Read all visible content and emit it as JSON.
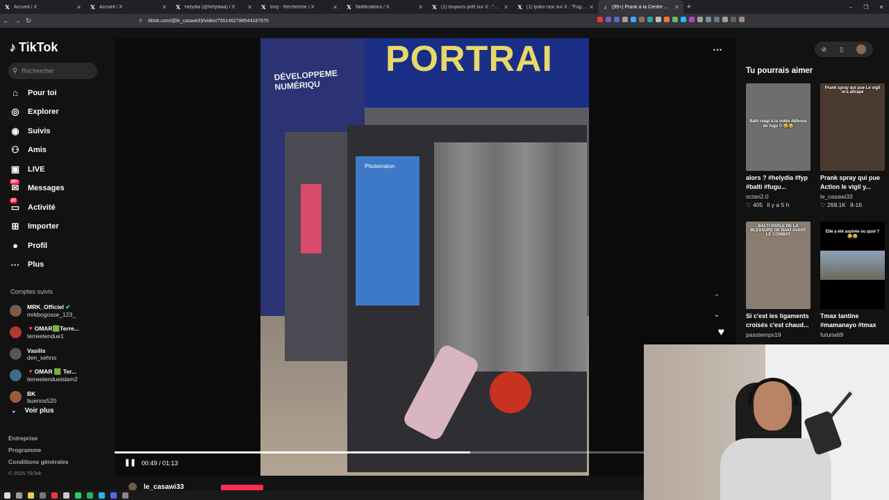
{
  "browser": {
    "tabs": [
      {
        "icon": "x-logo",
        "title": "Accueil / X"
      },
      {
        "icon": "x-logo",
        "title": "Accueil / X"
      },
      {
        "icon": "x-logo",
        "title": "helydia (@helydiaa) / X"
      },
      {
        "icon": "x-logo",
        "title": "trixy - Recherche / X"
      },
      {
        "icon": "x-logo",
        "title": "Notifications / X"
      },
      {
        "icon": "x-logo",
        "title": "(1) toujours prêt sur X : \"AHAHAHA"
      },
      {
        "icon": "x-logo",
        "title": "(1) lysko rsor sur X : \"Fugu quand il"
      },
      {
        "icon": "tiktok-logo",
        "title": "(99+) Prank à la Centre Comm",
        "active": true
      }
    ],
    "url": "tiktok.com/@le_casawi33/video/7551462788544187670",
    "new_tab": "+",
    "window_controls": [
      "–",
      "❐",
      "✕"
    ]
  },
  "sidebar": {
    "logo_text": "TikTok",
    "search_placeholder": "Rechercher",
    "nav": [
      {
        "icon": "home-icon",
        "glyph": "⌂",
        "label": "Pour toi"
      },
      {
        "icon": "compass-icon",
        "glyph": "◎",
        "label": "Explorer"
      },
      {
        "icon": "following-icon",
        "glyph": "◉",
        "label": "Suivis"
      },
      {
        "icon": "friends-icon",
        "glyph": "⚇",
        "label": "Amis"
      },
      {
        "icon": "live-icon",
        "glyph": "▣",
        "label": "LIVE"
      },
      {
        "icon": "messages-icon",
        "glyph": "✉",
        "label": "Messages",
        "badge": "99+"
      },
      {
        "icon": "activity-icon",
        "glyph": "▭",
        "label": "Activité",
        "badge": "22"
      },
      {
        "icon": "upload-icon",
        "glyph": "⊞",
        "label": "Importer"
      },
      {
        "icon": "profile-icon",
        "glyph": "●",
        "label": "Profil"
      },
      {
        "icon": "more-icon",
        "glyph": "···",
        "label": "Plus"
      }
    ],
    "followed_title": "Comptes suivis",
    "followed": [
      {
        "name": "MRK_Officiel",
        "handle": "mrkbogosse_123_",
        "verified": true,
        "color": "#7a5c48"
      },
      {
        "name": "🔻OMAR🟩Terre...",
        "handle": "terreetendue1",
        "color": "#b03a2e"
      },
      {
        "name": "Vasilis",
        "handle": "den_xehno",
        "color": "#555555"
      },
      {
        "name": "🔻OMAR 🟩 Ter...",
        "handle": "terreetendueislam2",
        "color": "#3a6e8c"
      },
      {
        "name": "BK",
        "handle": "buenos520",
        "color": "#9a5b3d"
      }
    ],
    "see_more": "Voir plus",
    "footer": [
      "Entreprise",
      "Programme",
      "Conditions générales"
    ],
    "copyright": "© 2025 TikTok"
  },
  "video": {
    "sign_text": "PORTRAI",
    "left_sign_text": "DÉVELOPPEME NUMÉRIQU",
    "booth_label": "Photomaton",
    "current_time": "00:49",
    "duration": "01:13",
    "time_display": "00:49 / 01:13",
    "progress_fraction": 0.671,
    "author": "le_casawi33"
  },
  "recommendations": {
    "title": "Tu pourrais aimer",
    "items": [
      {
        "thumb_text": "Balti réagi à la vidéo défense de fugu !! 😂😂",
        "caption": "alors ? #helydia #fyp #balti #fugu...",
        "user": "octan2.0",
        "likes": "405",
        "date": "Il y a 5 h",
        "bg": "#6e6e6e"
      },
      {
        "thumb_text": "Prank spray qui pue Le vigil m'a attrapé",
        "caption": "Prank spray qui pue Action le vigil y...",
        "user": "le_casawi33",
        "likes": "268.1K",
        "date": "8-16",
        "bg": "#4a3a30"
      },
      {
        "thumb_text": "BALTI PARLE DE LA BLESSURE DE BAKI AVANT LE COMBAT",
        "caption": "Si c'est les ligaments croisés c'est chaud...",
        "user": "passtemps19",
        "likes": "",
        "date": "",
        "bg": "#8a7d70"
      },
      {
        "thumb_text": "Elle a été aspirée ou quoi ? 😂😂",
        "caption": "Tmax tantine #mamanayo #tmax",
        "user": "futuria69",
        "likes": "",
        "date": "",
        "bg": "#000000"
      }
    ]
  },
  "colors": {
    "accent": "#fe2c55",
    "background": "#121212"
  }
}
